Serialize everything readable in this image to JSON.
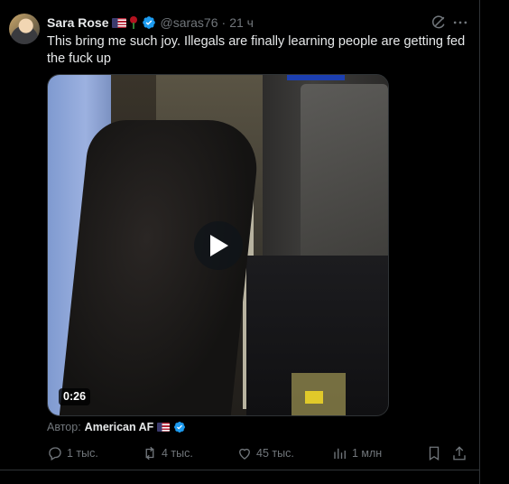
{
  "post": {
    "author_name": "Sara Rose",
    "handle": "@saras76",
    "separator": "·",
    "time": "21 ч",
    "text": "This bring me such joy. Illegals are finally learning people are getting fed the fuck up",
    "video": {
      "duration": "0:26"
    },
    "attribution": {
      "label": "Автор:",
      "author": "American AF"
    },
    "actions": {
      "replies": "1 тыс.",
      "reposts": "4 тыс.",
      "likes": "45 тыс.",
      "views": "1 млн"
    }
  },
  "colors": {
    "background": "#000000",
    "text_primary": "#e7e9ea",
    "text_secondary": "#71767b",
    "verified_blue": "#1d9bf0",
    "divider": "#2f3336"
  },
  "icons": [
    "grok-icon",
    "more-icon",
    "verified-icon",
    "play-icon",
    "reply-icon",
    "repost-icon",
    "like-icon",
    "views-icon",
    "bookmark-icon",
    "share-icon"
  ]
}
